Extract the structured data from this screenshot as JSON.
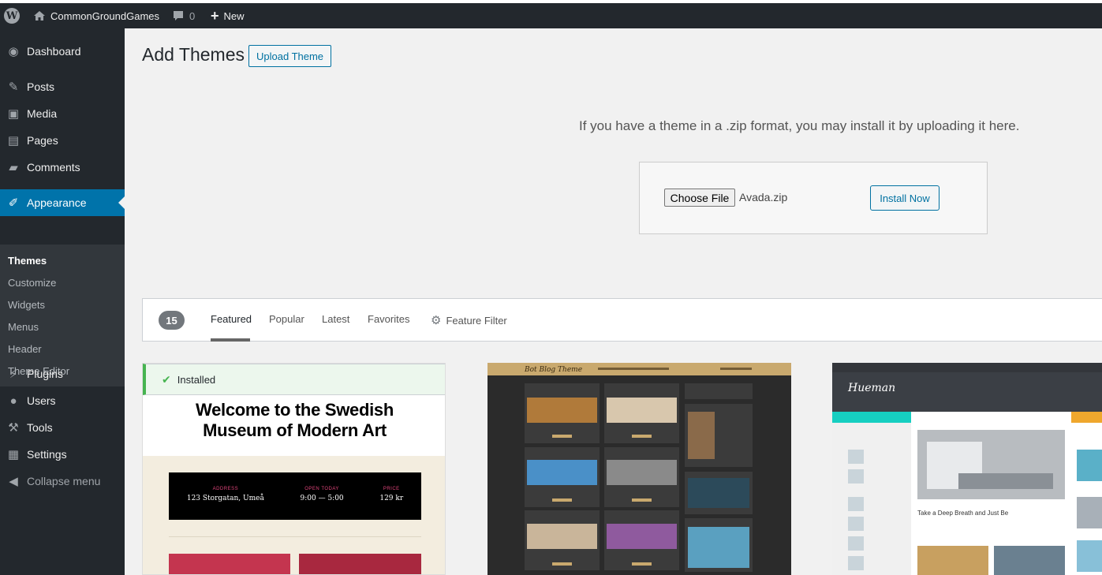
{
  "admin_bar": {
    "site_name": "CommonGroundGames",
    "comments_count": "0",
    "new_label": "New"
  },
  "sidebar": {
    "items": [
      {
        "label": "Dashboard",
        "icon": "dashboard-icon"
      },
      {
        "label": "Posts",
        "icon": "pin-icon"
      },
      {
        "label": "Media",
        "icon": "media-icon"
      },
      {
        "label": "Pages",
        "icon": "page-icon"
      },
      {
        "label": "Comments",
        "icon": "comment-icon"
      },
      {
        "label": "Appearance",
        "icon": "brush-icon"
      },
      {
        "label": "Plugins",
        "icon": "plug-icon"
      },
      {
        "label": "Users",
        "icon": "user-icon"
      },
      {
        "label": "Tools",
        "icon": "wrench-icon"
      },
      {
        "label": "Settings",
        "icon": "settings-icon"
      },
      {
        "label": "Collapse menu",
        "icon": "collapse-icon"
      }
    ],
    "submenu": [
      "Themes",
      "Customize",
      "Widgets",
      "Menus",
      "Header",
      "Theme Editor"
    ]
  },
  "page": {
    "title": "Add Themes",
    "upload_button": "Upload Theme",
    "upload_description": "If you have a theme in a .zip format, you may install it by uploading it here.",
    "choose_file": "Choose File",
    "file_name": "Avada.zip",
    "install_button": "Install Now"
  },
  "filter": {
    "count": "15",
    "tabs": [
      "Featured",
      "Popular",
      "Latest",
      "Favorites"
    ],
    "feature_filter": "Feature Filter",
    "current_tab": "Featured"
  },
  "themes": [
    {
      "installed_label": "Installed",
      "preview_heading_1": "Welcome to the Swedish",
      "preview_heading_2": "Museum of Modern Art",
      "info": [
        {
          "label": "ADDRESS",
          "value": "123 Storgatan, Umeå"
        },
        {
          "label": "OPEN TODAY",
          "value": "9:00 — 5:00"
        },
        {
          "label": "PRICE",
          "value": "129 kr"
        }
      ]
    },
    {
      "brand": "Bot Blog Theme"
    },
    {
      "brand": "Hueman",
      "headline": "Take a Deep Breath and Just Be"
    }
  ],
  "colors": {
    "admin_dark": "#23282d",
    "accent": "#0073aa",
    "installed_green": "#46b450"
  }
}
